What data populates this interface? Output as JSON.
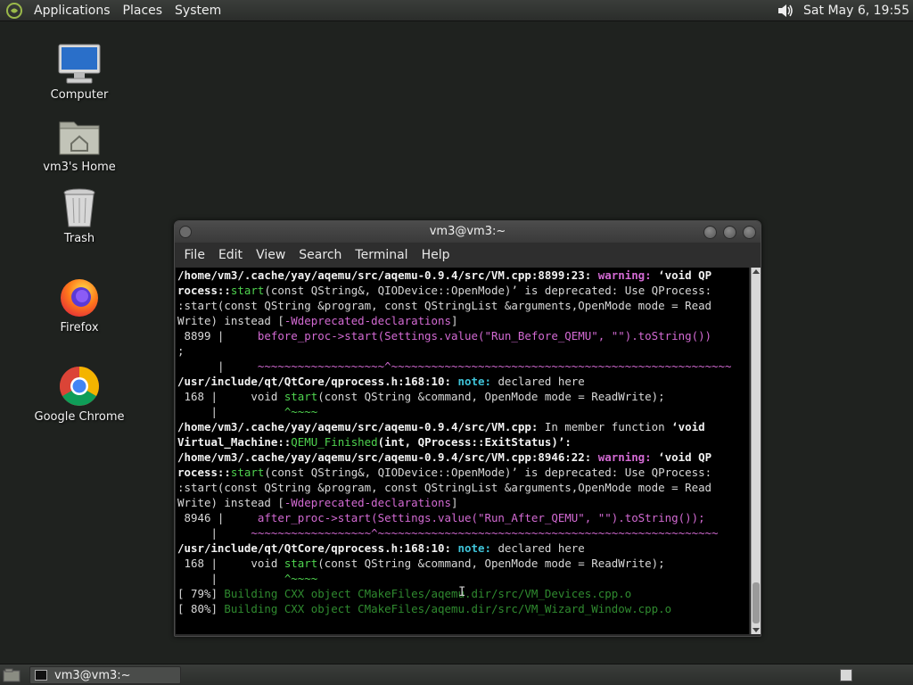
{
  "top_panel": {
    "menus": [
      "Applications",
      "Places",
      "System"
    ],
    "clock": "Sat May  6, 19:55"
  },
  "desktop_icons": [
    {
      "label": "Computer",
      "icon": "computer-icon"
    },
    {
      "label": "vm3's Home",
      "icon": "home-folder-icon"
    },
    {
      "label": "Trash",
      "icon": "trash-icon"
    },
    {
      "label": "Firefox",
      "icon": "firefox-icon"
    },
    {
      "label": "Google Chrome",
      "icon": "chrome-icon"
    }
  ],
  "terminal": {
    "title": "vm3@vm3:~",
    "menus": [
      "File",
      "Edit",
      "View",
      "Search",
      "Terminal",
      "Help"
    ],
    "lines": [
      [
        [
          "b",
          "/home/vm3/.cache/yay/aqemu/src/aqemu-0.9.4/src/VM.cpp:8899:23: "
        ],
        [
          "w",
          "warning: "
        ],
        [
          "b",
          "‘void QP"
        ]
      ],
      [
        [
          "b",
          "rocess::"
        ],
        [
          "f",
          "start"
        ],
        [
          "",
          "(const QString&, QIODevice::OpenMode)’ is deprecated: Use QProcess:"
        ]
      ],
      [
        [
          "",
          ":start(const QString &program, const QStringList &arguments,OpenMode mode = Read"
        ]
      ],
      [
        [
          "",
          "Write) instead ["
        ],
        [
          "m",
          "-Wdeprecated-declarations"
        ],
        [
          "",
          "]"
        ]
      ],
      [
        [
          "",
          " 8899 |     "
        ],
        [
          "m",
          "before_proc->start(Settings.value(\"Run_Before_QEMU\", \"\").toString())"
        ]
      ],
      [
        [
          "",
          ";"
        ]
      ],
      [
        [
          "",
          " "
        ],
        [
          "",
          "     |     "
        ],
        [
          "tild",
          "~~~~~~~~~~~~~~~~~~~^~~~~~~~~~~~~~~~~~~~~~~~~~~~~~~~~~~~~~~~~~~~~~~~~~~~"
        ]
      ],
      [
        [
          "b",
          "/usr/include/qt/QtCore/qprocess.h:168:10: "
        ],
        [
          "n",
          "note: "
        ],
        [
          "",
          "declared here"
        ]
      ],
      [
        [
          "",
          " 168 |     void "
        ],
        [
          "f",
          "start"
        ],
        [
          "",
          "(const QString &command, OpenMode mode = ReadWrite);"
        ]
      ],
      [
        [
          "",
          "     |          "
        ],
        [
          "g",
          "^~~~~"
        ]
      ],
      [
        [
          "b",
          "/home/vm3/.cache/yay/aqemu/src/aqemu-0.9.4/src/VM.cpp: "
        ],
        [
          "",
          "In member function "
        ],
        [
          "b",
          "‘void"
        ]
      ],
      [
        [
          "b",
          "Virtual_Machine::"
        ],
        [
          "f",
          "QEMU_Finished"
        ],
        [
          "b",
          "(int, QProcess::ExitStatus)’:"
        ]
      ],
      [
        [
          "b",
          "/home/vm3/.cache/yay/aqemu/src/aqemu-0.9.4/src/VM.cpp:8946:22: "
        ],
        [
          "w",
          "warning: "
        ],
        [
          "b",
          "‘void QP"
        ]
      ],
      [
        [
          "b",
          "rocess::"
        ],
        [
          "f",
          "start"
        ],
        [
          "",
          "(const QString&, QIODevice::OpenMode)’ is deprecated: Use QProcess:"
        ]
      ],
      [
        [
          "",
          ":start(const QString &program, const QStringList &arguments,OpenMode mode = Read"
        ]
      ],
      [
        [
          "",
          "Write) instead ["
        ],
        [
          "m",
          "-Wdeprecated-declarations"
        ],
        [
          "",
          "]"
        ]
      ],
      [
        [
          "",
          " 8946 |     "
        ],
        [
          "m",
          "after_proc->start(Settings.value(\"Run_After_QEMU\", \"\").toString());"
        ]
      ],
      [
        [
          "",
          "     |     "
        ],
        [
          "tild",
          "~~~~~~~~~~~~~~~~~~^~~~~~~~~~~~~~~~~~~~~~~~~~~~~~~~~~~~~~~~~~~~~~~~~~~~"
        ]
      ],
      [
        [
          "b",
          "/usr/include/qt/QtCore/qprocess.h:168:10: "
        ],
        [
          "n",
          "note: "
        ],
        [
          "",
          "declared here"
        ]
      ],
      [
        [
          "",
          " 168 |     void "
        ],
        [
          "f",
          "start"
        ],
        [
          "",
          "(const QString &command, OpenMode mode = ReadWrite);"
        ]
      ],
      [
        [
          "",
          "     |          "
        ],
        [
          "g",
          "^~~~~"
        ]
      ],
      [
        [
          "",
          "[ 79%] "
        ],
        [
          "dg",
          "Building CXX object CMakeFiles/aqemu.dir/src/VM_Devices.cpp.o"
        ]
      ],
      [
        [
          "",
          "[ 80%] "
        ],
        [
          "dg",
          "Building CXX object CMakeFiles/aqemu.dir/src/VM_Wizard_Window.cpp.o"
        ]
      ]
    ]
  },
  "taskbar": {
    "task_label": "vm3@vm3:~"
  }
}
